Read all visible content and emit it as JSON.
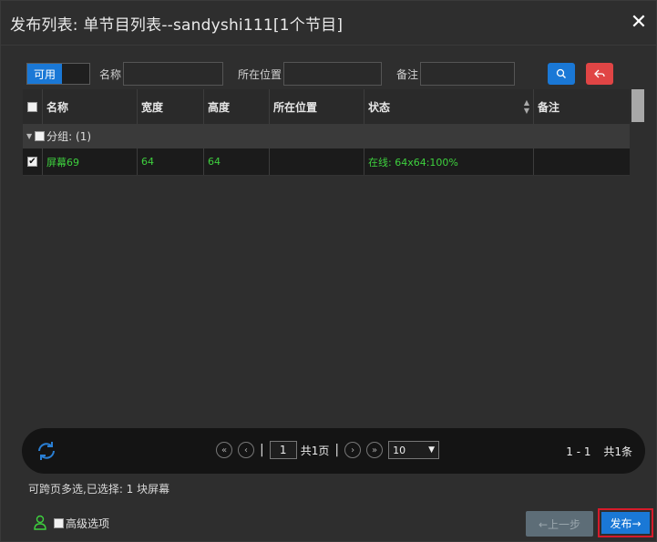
{
  "dialog": {
    "title": "发布列表: 单节目列表--sandyshi111[1个节目]"
  },
  "filter": {
    "toggle_label": "可用",
    "name_label": "名称",
    "name_value": "",
    "location_label": "所在位置",
    "location_value": "",
    "note_label": "备注",
    "note_value": ""
  },
  "table": {
    "columns": [
      "名称",
      "宽度",
      "高度",
      "所在位置",
      "状态",
      "备注"
    ],
    "group_label": "分组: (1)",
    "rows": [
      {
        "name": "屏幕69",
        "width": "64",
        "height": "64",
        "location": "",
        "status": "在线: 64x64:100%",
        "note": ""
      }
    ]
  },
  "pager": {
    "current_page": "1",
    "total_pages": "共1页",
    "page_size": "10",
    "range": "1 - 1",
    "total": "共1条"
  },
  "footer": {
    "hint": "可跨页多选,已选择:  1 块屏幕",
    "advanced": "高级选项",
    "prev": "←上一步",
    "publish": "发布→"
  },
  "colors": {
    "accent": "#1a78d6",
    "danger": "#e04545",
    "online": "#3ed13e",
    "highlight": "#d61b2a"
  }
}
